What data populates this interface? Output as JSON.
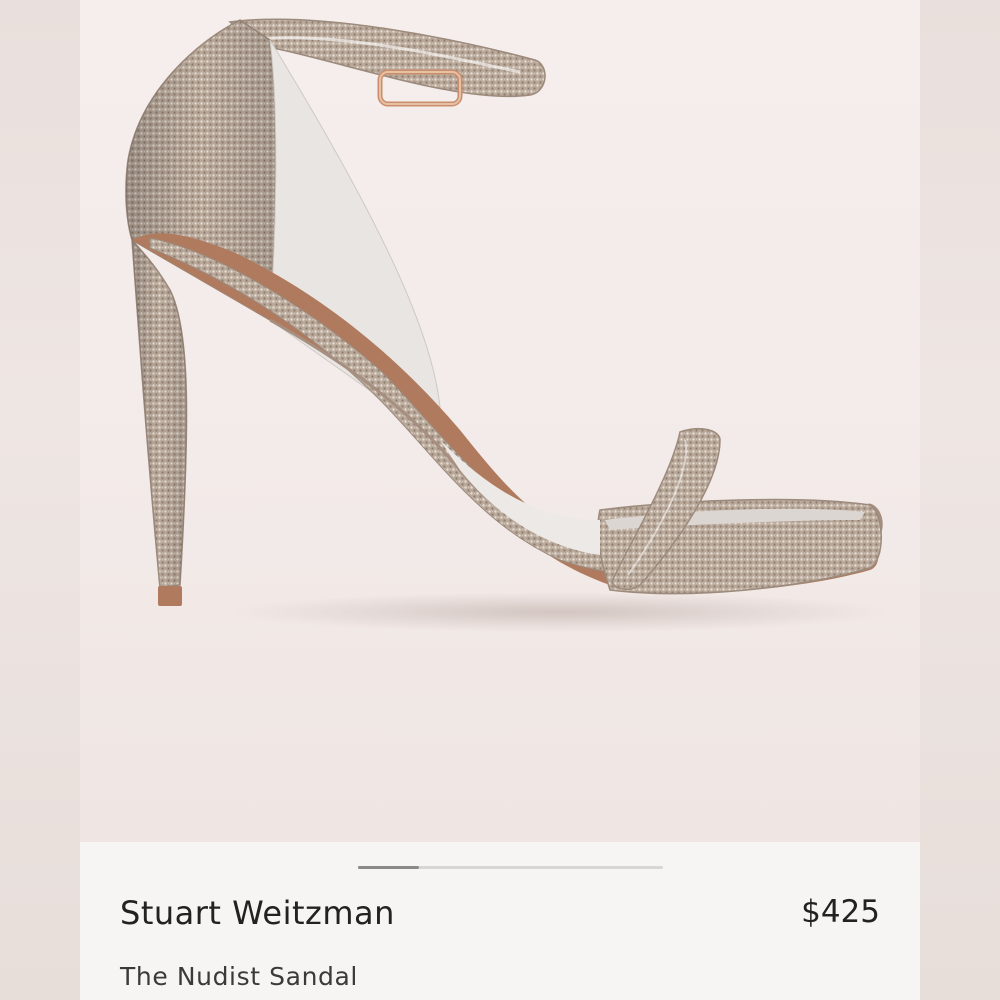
{
  "product": {
    "brand": "Stuart Weitzman",
    "price": "$425",
    "name": "The Nudist Sandal",
    "image_icon": "sandal-image",
    "colors": {
      "background": "#f3ecea",
      "panel": "#f6f5f4",
      "text": "#222222",
      "shoe": "#b7a395",
      "sole": "#b07a5e"
    }
  },
  "gallery": {
    "image_index": 1,
    "image_count": 5,
    "progress_fraction": 0.2
  }
}
